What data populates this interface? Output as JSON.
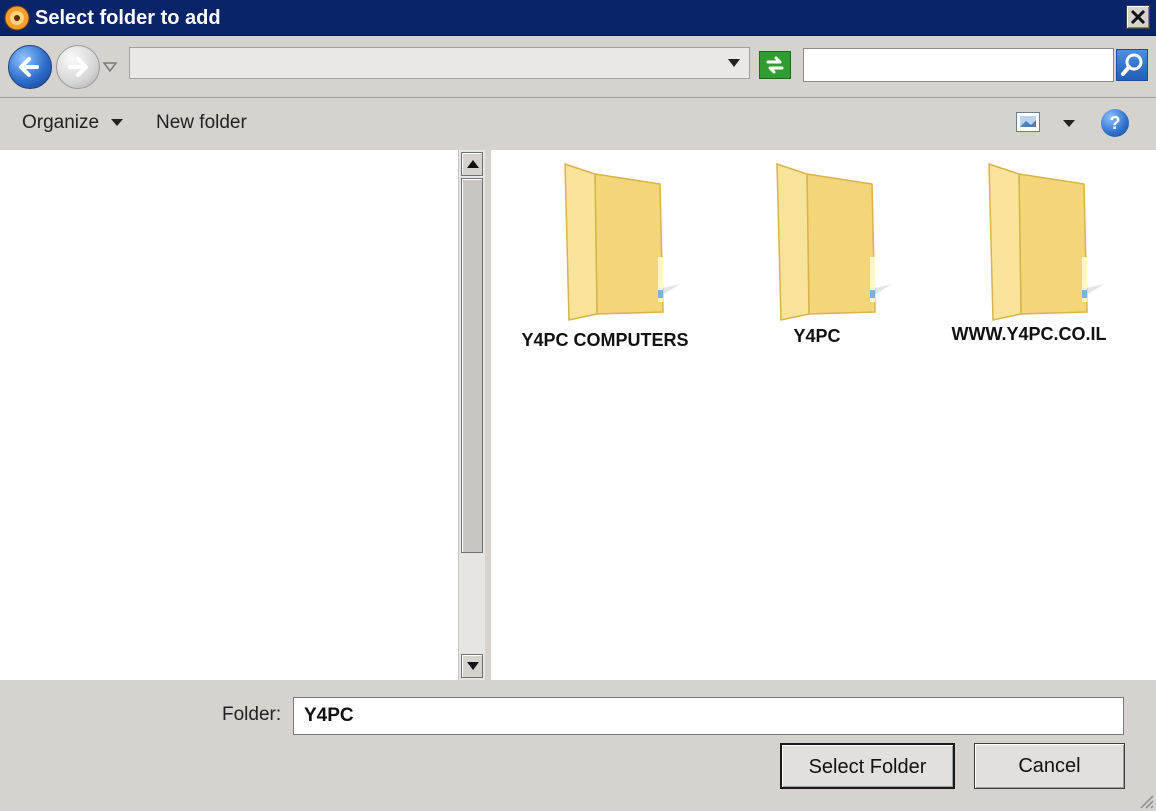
{
  "window": {
    "title": "Select folder to add",
    "close_glyph": "✕"
  },
  "navigation": {
    "back_icon": "back-arrow-icon",
    "forward_icon": "forward-arrow-icon",
    "address_value": "",
    "search_placeholder": ""
  },
  "toolbar": {
    "organize_label": "Organize",
    "new_folder_label": "New folder",
    "help_glyph": "?"
  },
  "folders": [
    {
      "name": "Y4PC COMPUTERS"
    },
    {
      "name": "Y4PC"
    },
    {
      "name": "WWW.Y4PC.CO.IL"
    }
  ],
  "footer": {
    "folder_label": "Folder:",
    "folder_value": "Y4PC",
    "select_button": "Select Folder",
    "cancel_button": "Cancel"
  },
  "colors": {
    "title_bar": "#0a246a",
    "dialog_bg": "#d6d3ce",
    "folder_yellow": "#f2d77a"
  }
}
